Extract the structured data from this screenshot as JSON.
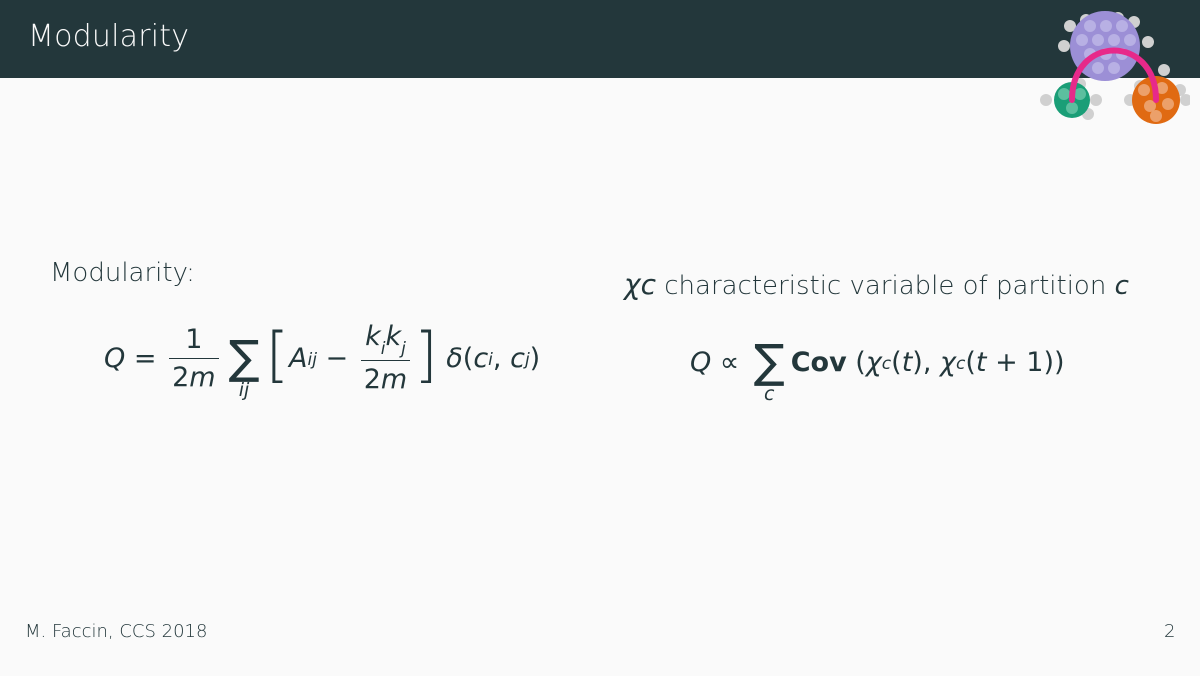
{
  "header": {
    "title": "Modularity"
  },
  "left": {
    "label": "Modularity:"
  },
  "right": {
    "label_var": "χc",
    "label_text": " characteristic variable of partition ",
    "label_c": "c"
  },
  "footer": {
    "author": "M. Faccin, CCS 2018",
    "page_number": "2"
  },
  "colors": {
    "header_bg": "#23373b",
    "purple": "#9c8fd6",
    "green": "#1a9e77",
    "orange": "#e06a12",
    "arc": "#e7298a"
  }
}
